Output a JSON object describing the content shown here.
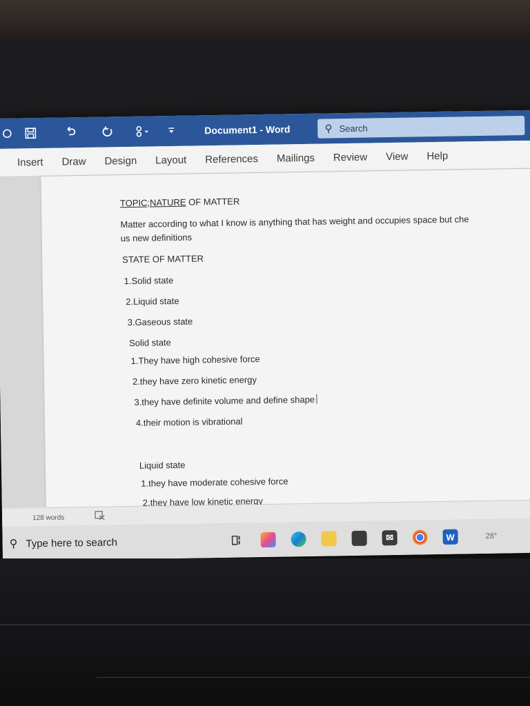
{
  "window": {
    "title": "Document1 - Word",
    "search_placeholder": "Search",
    "title_icons": [
      "autosave-icon",
      "save-icon",
      "undo-icon",
      "redo-icon",
      "touch-mode-icon",
      "customize-icon"
    ]
  },
  "ribbon": {
    "tabs": [
      "Insert",
      "Draw",
      "Design",
      "Layout",
      "References",
      "Mailings",
      "Review",
      "View",
      "Help"
    ]
  },
  "document": {
    "title_underlined": "TOPIC;NATURE",
    "title_rest": " OF MATTER",
    "paragraph_line1": "Matter according to what I know is anything that has weight and occupies space but che",
    "paragraph_line2": "us new definitions",
    "heading_states": "STATE OF MATTER",
    "states": [
      "1.Solid state",
      "2.Liquid state",
      "3.Gaseous state"
    ],
    "solid_heading": "Solid state",
    "solid_points": [
      "1.They have high cohesive force",
      "2.they have zero kinetic energy",
      "3.they have definite volume and define shape",
      "4.their motion is vibrational"
    ],
    "liquid_heading": "Liquid state",
    "liquid_points": [
      "1.they have moderate cohesive force",
      "2.they have low kinetic energy"
    ]
  },
  "status": {
    "word_count": "128 words",
    "right_text": "28°"
  },
  "taskbar": {
    "search_placeholder": "Type here to search",
    "icons": [
      "task-view-icon",
      "copilot-icon",
      "edge-icon",
      "file-explorer-icon",
      "store-icon",
      "mail-icon",
      "chrome-icon",
      "word-icon"
    ]
  },
  "colors": {
    "word_blue": "#2b579a",
    "search_box": "#bcd0ea",
    "page": "#f4f4f4"
  }
}
